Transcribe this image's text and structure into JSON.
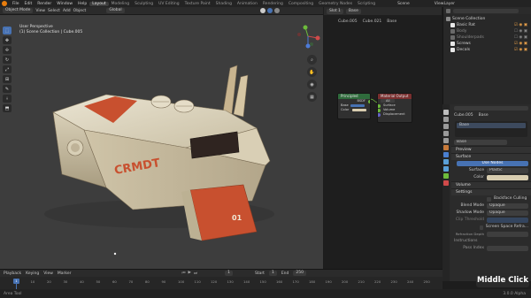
{
  "menu": [
    "File",
    "Edit",
    "Render",
    "Window",
    "Help"
  ],
  "workspaces": [
    "Layout",
    "Modeling",
    "Sculpting",
    "UV Editing",
    "Texture Paint",
    "Shading",
    "Animation",
    "Rendering",
    "Compositing",
    "Geometry Nodes",
    "Scripting"
  ],
  "scene_label": "Scene",
  "view_layer_label": "ViewLayer",
  "viewport": {
    "mode": "Object Mode",
    "menu": [
      "View",
      "Select",
      "Add",
      "Object"
    ],
    "orientation": "Global",
    "info_line1": "User Perspective",
    "info_line2": "(1) Scene Collection | Cube.005",
    "tools": [
      "⬚",
      "✥",
      "✢",
      "↻",
      "⤢",
      "⊞",
      "✎",
      "⟊",
      "⬒"
    ]
  },
  "nodeeditor": {
    "header_items": [
      "Slot 1",
      "Base"
    ],
    "breadcrumb": [
      "Cube.005",
      "Cube.021",
      "Base"
    ],
    "nodes": {
      "shader_title": "Principled",
      "output_title": "Material Output",
      "output_target": "All",
      "output_rows": [
        "Surface",
        "Volume",
        "Displacement"
      ],
      "shader_rows": [
        "BSDF",
        "Base",
        "Color"
      ]
    }
  },
  "outliner": {
    "title": "Scene Collection",
    "items": [
      {
        "label": "Basic Rat",
        "dim": false
      },
      {
        "label": "Body",
        "dim": true
      },
      {
        "label": "Shoulderpads",
        "dim": true
      },
      {
        "label": "Screws",
        "dim": false
      },
      {
        "label": "Decals",
        "dim": false
      }
    ]
  },
  "properties": {
    "object_path": [
      "Cube.005",
      "Base"
    ],
    "material_slot": "Base",
    "material_name": "Base",
    "sections": {
      "preview": "Preview",
      "surface": "Surface",
      "use_nodes": "Use Nodes",
      "surface_label": "Surface",
      "surface_value": "Plastic",
      "color_label": "Color",
      "volume": "Volume",
      "settings": "Settings",
      "backface": "Backface Culling",
      "blend_label": "Blend Mode",
      "blend_value": "Opaque",
      "shadow_label": "Shadow Mode",
      "shadow_value": "Opaque",
      "clip_label": "Clip Threshold",
      "ssr": "Screen Space Refra...",
      "refraction": "Refraction Depth",
      "pass_index": "Pass Index",
      "instructions": "Instructions"
    },
    "base_color": "#d8cdb0"
  },
  "timeline": {
    "menu": [
      "Playback",
      "Keying",
      "View",
      "Marker"
    ],
    "current_frame": "1",
    "start": "Start",
    "start_value": "1",
    "end": "End",
    "end_value": "250",
    "ticks": [
      "0",
      "10",
      "20",
      "30",
      "40",
      "50",
      "60",
      "70",
      "80",
      "90",
      "100",
      "110",
      "120",
      "130",
      "140",
      "150",
      "160",
      "170",
      "180",
      "190",
      "200",
      "210",
      "220",
      "230",
      "240",
      "250"
    ]
  },
  "status_text": "Area Tool",
  "version": "3.0.0 Alpha",
  "overlay_label": "Middle Click",
  "decals": {
    "ship_name": "CRMDT",
    "ramp_number": "01"
  },
  "colors": {
    "accent": "#4772b3",
    "brand": "#e87d0d",
    "rust": "#c8502f"
  }
}
